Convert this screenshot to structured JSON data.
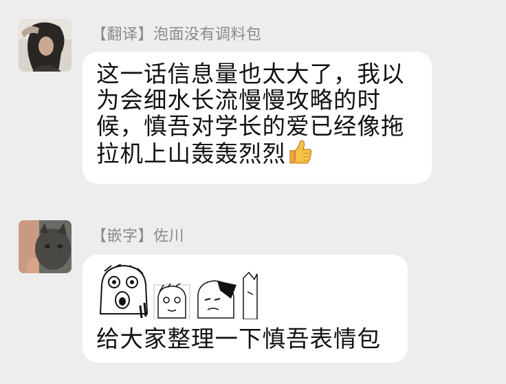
{
  "messages": [
    {
      "sender": "【翻译】泡面没有调料包",
      "text": "这一话信息量也太大了，我以为会细水长流慢慢攻略的时候，慎吾对学长的爱已经像拖拉机上山轰轰烈烈",
      "emoji": "thumbs-up"
    },
    {
      "sender": "【嵌字】佐川",
      "text": "给大家整理一下慎吾表情包",
      "attachment": "manga-sticker-strip"
    }
  ]
}
